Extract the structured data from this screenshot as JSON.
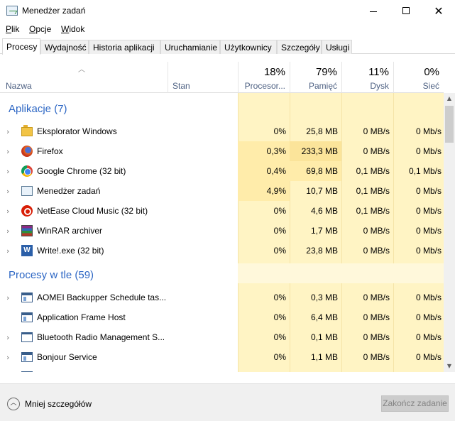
{
  "window": {
    "title": "Menedżer zadań"
  },
  "menu": [
    "Plik",
    "Opcje",
    "Widok"
  ],
  "tabs": [
    {
      "label": "Procesy",
      "active": true
    },
    {
      "label": "Wydajność"
    },
    {
      "label": "Historia aplikacji"
    },
    {
      "label": "Uruchamianie"
    },
    {
      "label": "Użytkownicy"
    },
    {
      "label": "Szczegóły"
    },
    {
      "label": "Usługi"
    }
  ],
  "columns": {
    "name": "Nazwa",
    "status": "Stan",
    "cpu": {
      "label": "Procesor...",
      "percent": "18%"
    },
    "memory": {
      "label": "Pamięć",
      "percent": "79%"
    },
    "disk": {
      "label": "Dysk",
      "percent": "11%"
    },
    "network": {
      "label": "Sieć",
      "percent": "0%"
    }
  },
  "groups": {
    "apps": "Aplikacje (7)",
    "background": "Procesy w tle (59)"
  },
  "apps": [
    {
      "name": "Eksplorator Windows",
      "icon": "folder-icon",
      "cpu": "0%",
      "mem": "25,8 MB",
      "disk": "0 MB/s",
      "net": "0 Mb/s"
    },
    {
      "name": "Firefox",
      "icon": "firefox-icon",
      "cpu": "0,3%",
      "mem": "233,3 MB",
      "disk": "0 MB/s",
      "net": "0 Mb/s"
    },
    {
      "name": "Google Chrome (32 bit)",
      "icon": "chrome-icon",
      "cpu": "0,4%",
      "mem": "69,8 MB",
      "disk": "0,1 MB/s",
      "net": "0,1 Mb/s"
    },
    {
      "name": "Menedżer zadań",
      "icon": "task-manager-icon",
      "cpu": "4,9%",
      "mem": "10,7 MB",
      "disk": "0,1 MB/s",
      "net": "0 Mb/s"
    },
    {
      "name": "NetEase Cloud Music (32 bit)",
      "icon": "netease-icon",
      "cpu": "0%",
      "mem": "4,6 MB",
      "disk": "0,1 MB/s",
      "net": "0 Mb/s"
    },
    {
      "name": "WinRAR archiver",
      "icon": "winrar-icon",
      "cpu": "0%",
      "mem": "1,7 MB",
      "disk": "0 MB/s",
      "net": "0 Mb/s"
    },
    {
      "name": "Write!.exe (32 bit)",
      "icon": "write-icon",
      "cpu": "0%",
      "mem": "23,8 MB",
      "disk": "0 MB/s",
      "net": "0 Mb/s"
    }
  ],
  "background": [
    {
      "name": "AOMEI Backupper Schedule tas...",
      "icon": "service-icon",
      "expandable": true,
      "cpu": "0%",
      "mem": "0,3 MB",
      "disk": "0 MB/s",
      "net": "0 Mb/s"
    },
    {
      "name": "Application Frame Host",
      "icon": "service-icon",
      "expandable": false,
      "cpu": "0%",
      "mem": "6,4 MB",
      "disk": "0 MB/s",
      "net": "0 Mb/s"
    },
    {
      "name": "Bluetooth Radio Management S...",
      "icon": "window-icon",
      "expandable": true,
      "cpu": "0%",
      "mem": "0,1 MB",
      "disk": "0 MB/s",
      "net": "0 Mb/s"
    },
    {
      "name": "Bonjour Service",
      "icon": "service-icon",
      "expandable": true,
      "cpu": "0%",
      "mem": "1,1 MB",
      "disk": "0 MB/s",
      "net": "0 Mb/s"
    }
  ],
  "footer": {
    "less_details": "Mniej szczegółów",
    "end_task": "Zakończ zadanie"
  },
  "colors": {
    "heat_light": "#fff4c4",
    "heat_mid": "#ffecaa",
    "heat_strong": "#fbe49a",
    "group_title": "#2c66c4",
    "header_text": "#4d6082"
  }
}
